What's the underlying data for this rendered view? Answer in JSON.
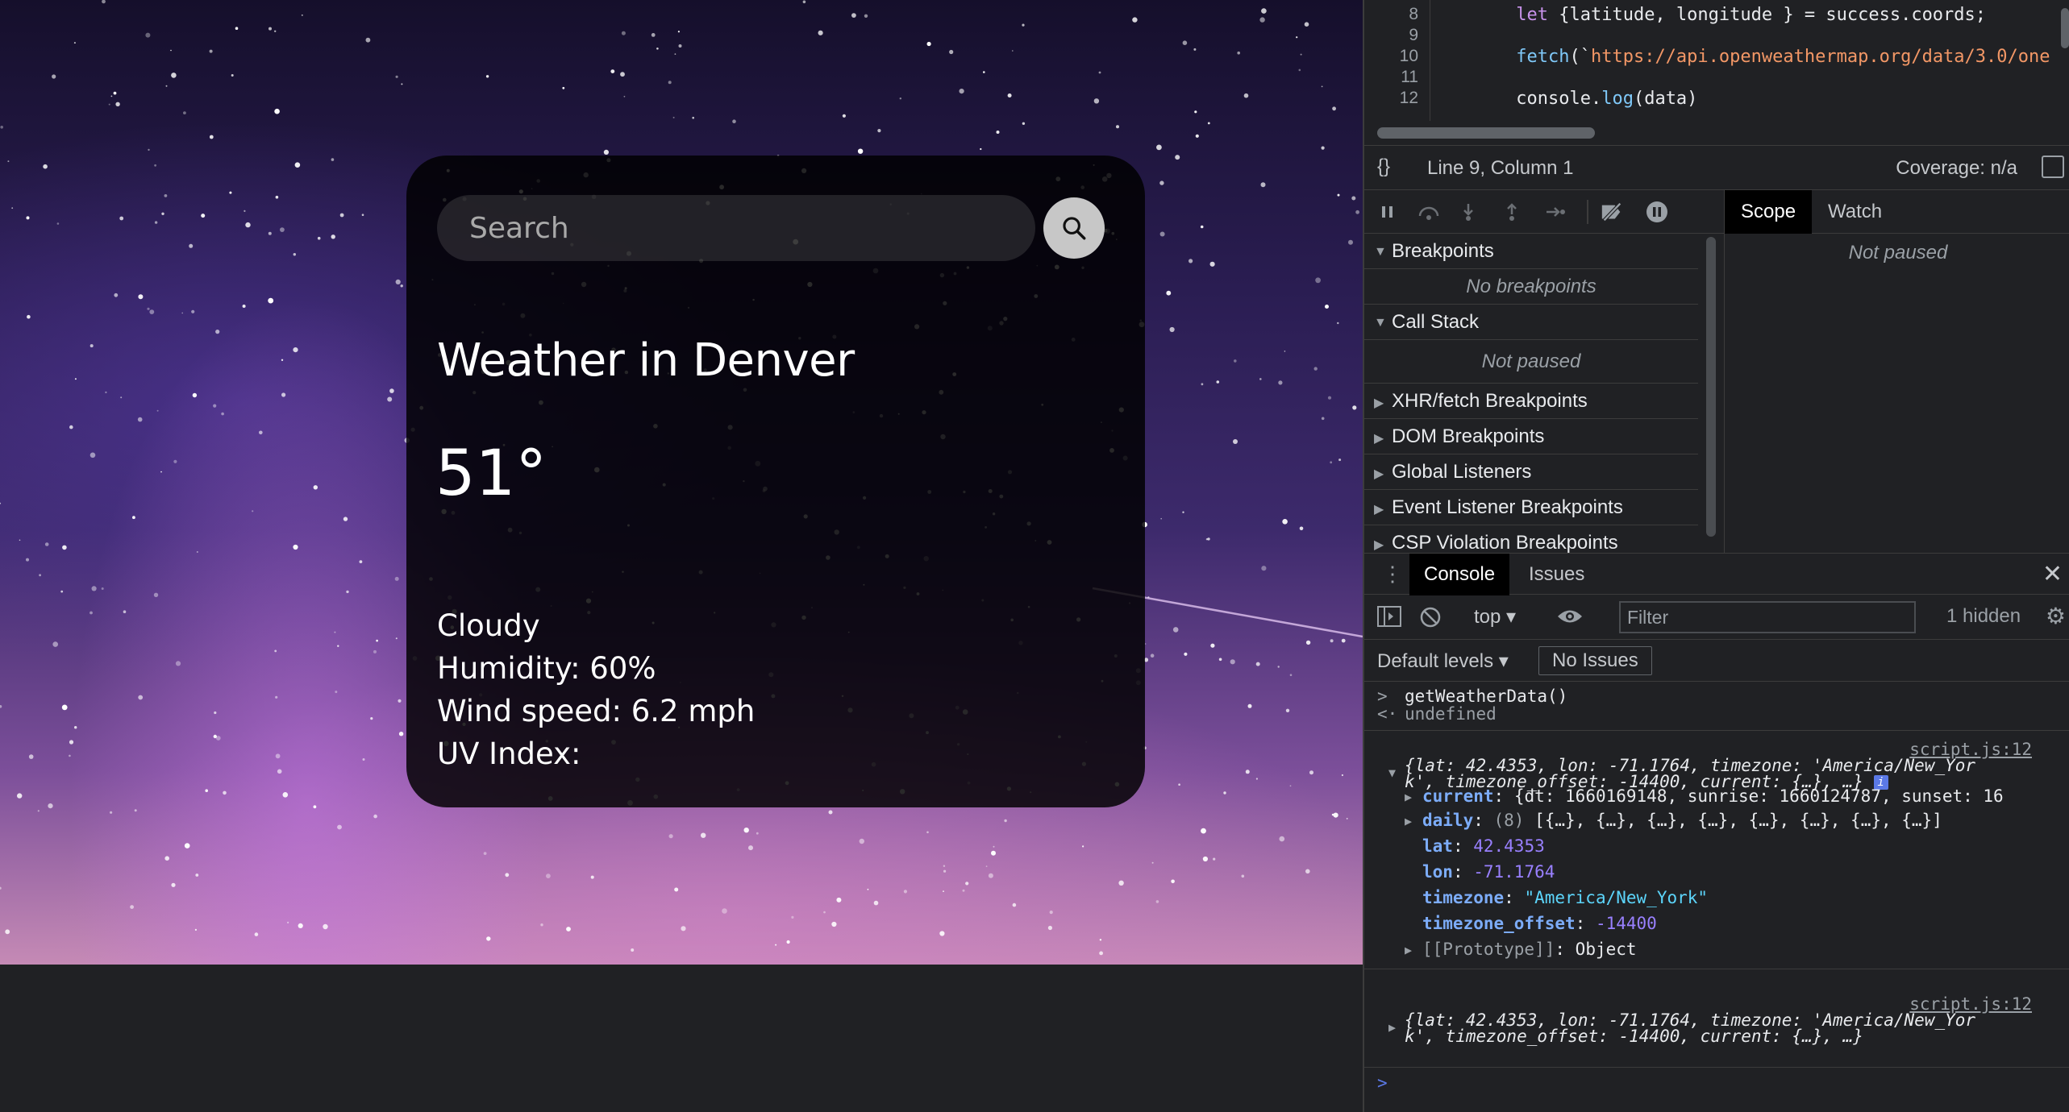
{
  "page": {
    "search": {
      "placeholder": "Search"
    },
    "weather": {
      "city": "Weather in Denver",
      "temperature": "51°",
      "description": "Cloudy",
      "humidity": "Humidity: 60%",
      "wind": "Wind speed: 6.2 mph",
      "uv": "UV Index:"
    }
  },
  "devtools": {
    "source": {
      "line_numbers": [
        "8",
        "9",
        "10",
        "11",
        "12"
      ],
      "lines": [
        {
          "indent": "     ",
          "kw": "let",
          "rest": " {latitude, longitude } = success.coords;"
        },
        {
          "blank": ""
        },
        {
          "indent": "     ",
          "fn": "fetch",
          "rest": "(`",
          "str": "https://api.openweathermap.org/data/3.0/one"
        },
        {
          "blank": ""
        },
        {
          "indent": "     ",
          "rest": "console.",
          "fn2": "log",
          "rest2": "(data)"
        }
      ]
    },
    "status": {
      "braces": "{}",
      "position": "Line 9, Column 1",
      "coverage": "Coverage: n/a"
    },
    "sidebar_tabs": [
      "Scope",
      "Watch"
    ],
    "scope_note": "Not paused",
    "breakpoint_sections": [
      {
        "label": "Breakpoints",
        "expanded": true,
        "note": "No breakpoints"
      },
      {
        "label": "Call Stack",
        "expanded": true,
        "note": "Not paused"
      },
      {
        "label": "XHR/fetch Breakpoints",
        "expanded": false
      },
      {
        "label": "DOM Breakpoints",
        "expanded": false
      },
      {
        "label": "Global Listeners",
        "expanded": false
      },
      {
        "label": "Event Listener Breakpoints",
        "expanded": false
      },
      {
        "label": "CSP Violation Breakpoints",
        "expanded": false
      }
    ],
    "drawer_tabs": [
      "Console",
      "Issues"
    ],
    "console_toolbar": {
      "context": "top",
      "filter_placeholder": "Filter",
      "hidden": "1 hidden"
    },
    "levels": {
      "label": "Default levels",
      "issues": "No Issues"
    },
    "console": {
      "command": "getWeatherData()",
      "result": "undefined",
      "source_link": "script.js:12",
      "object_summary_line1": "{lat: 42.4353, lon: -71.1764, timezone: 'America/New_Yor",
      "object_summary_line2": "k', timezone_offset: -14400, current: {…}, …}",
      "props": {
        "current": {
          "key": "current",
          "value": "{dt: 1660169148, sunrise: 1660124787, sunset: 16"
        },
        "daily": {
          "key": "daily",
          "count": "(8)",
          "value": "[{…}, {…}, {…}, {…}, {…}, {…}, {…}, {…}]"
        },
        "lat": {
          "key": "lat",
          "value": "42.4353"
        },
        "lon": {
          "key": "lon",
          "value": "-71.1764"
        },
        "timezone": {
          "key": "timezone",
          "value": "\"America/New_York\""
        },
        "timezone_offset": {
          "key": "timezone_offset",
          "value": "-14400"
        },
        "prototype": {
          "key": "[[Prototype]]",
          "value": "Object"
        }
      }
    }
  },
  "colors": {
    "card_background": "#000000",
    "devtools_background": "#202124",
    "active_tab": "#000000",
    "console_key": "#7cacf8",
    "console_number": "#9980ff",
    "console_string": "#5cd5fb"
  }
}
